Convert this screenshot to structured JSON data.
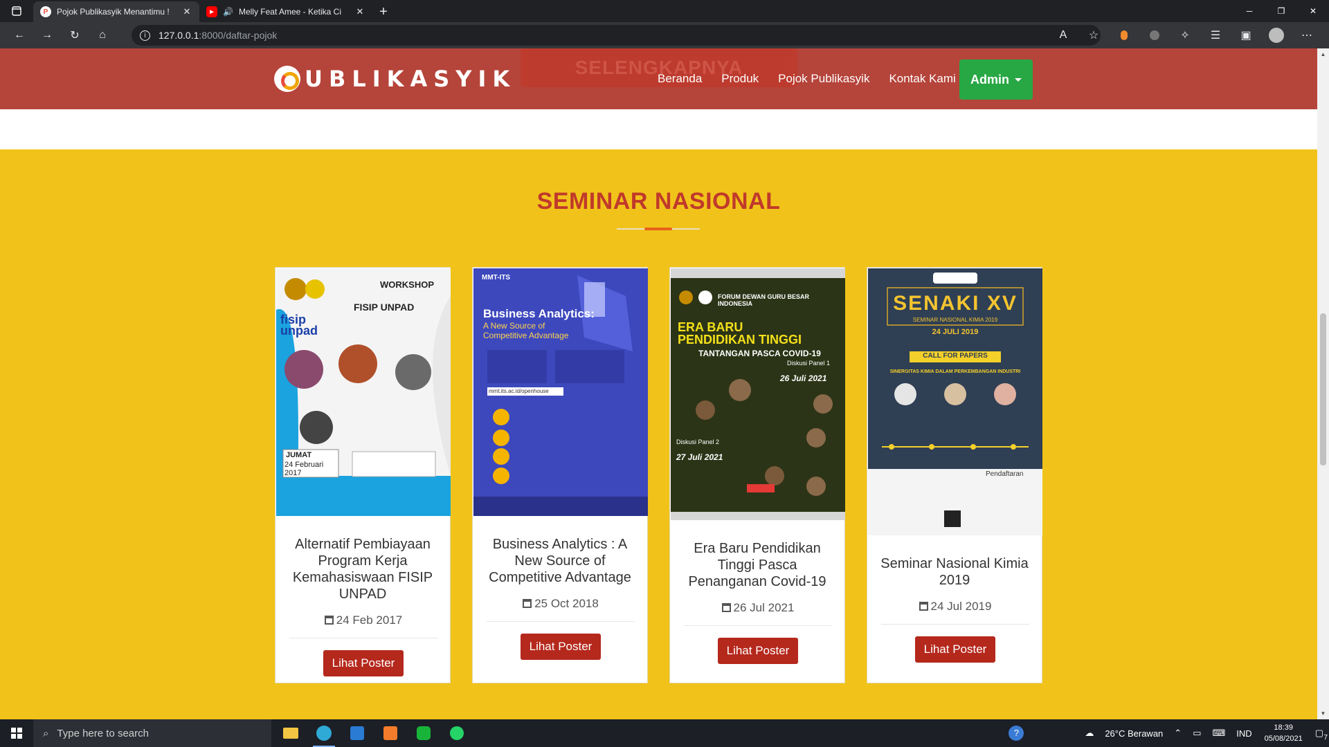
{
  "browser": {
    "tabs": [
      {
        "title": "Pojok Publikasyik Menantimu !",
        "active": true
      },
      {
        "title": "Melly Feat Amee - Ketika Ci",
        "active": false
      }
    ],
    "url_host": "127.0.0.1",
    "url_rest": ":8000/daftar-pojok"
  },
  "header": {
    "logo_text": "UBLIKASYIK",
    "ghost_button": "SELENGKAPNYA",
    "nav": [
      "Beranda",
      "Produk",
      "Pojok Publikasyik",
      "Kontak Kami"
    ],
    "admin_label": "Admin"
  },
  "section": {
    "title": "SEMINAR NASIONAL"
  },
  "cards": [
    {
      "title": "Alternatif Pembiayaan Program Kerja Kemahasiswaan FISIP UNPAD",
      "date": "24 Feb 2017",
      "button": "Lihat Poster",
      "poster": {
        "heading": "WORKSHOP",
        "subheading": "FISIP UNPAD",
        "brand": "fisip unpad",
        "day": "JUMAT",
        "date": "24 Februari 2017"
      }
    },
    {
      "title": "Business Analytics : A New Source of Competitive Advantage",
      "date": "25 Oct 2018",
      "button": "Lihat Poster",
      "poster": {
        "brand": "MMT-ITS",
        "heading": "Business Analytics:",
        "subheading": "A New Source of Competitive Advantage",
        "url": "mmt.its.ac.id/openhouse"
      }
    },
    {
      "title": "Era Baru Pendidikan Tinggi Pasca Penanganan Covid-19",
      "date": "26 Jul 2021",
      "button": "Lihat Poster",
      "poster": {
        "top": "FORUM DEWAN GURU BESAR INDONESIA",
        "heading": "ERA BARU PENDIDIKAN TINGGI",
        "subheading": "TANTANGAN PASCA COVID-19",
        "date1": "26 Juli 2021",
        "date2": "27 Juli 2021",
        "panel1": "Diskusi Panel 1",
        "panel2": "Diskusi Panel 2"
      }
    },
    {
      "title": "Seminar Nasional Kimia 2019",
      "date": "24 Jul 2019",
      "button": "Lihat Poster",
      "poster": {
        "heading": "SENAKI XV",
        "subheading": "SEMINAR NASIONAL KIMIA 2019",
        "date": "24 JULI 2019",
        "cfp": "CALL FOR PAPERS",
        "theme": "SINERGITAS KIMIA DALAM PERKEMBANGAN INDUSTRI",
        "reg": "Pendaftaran"
      }
    }
  ],
  "taskbar": {
    "search_placeholder": "Type here to search",
    "weather": "26°C  Berawan",
    "lang": "IND",
    "time": "18:39",
    "date": "05/08/2021",
    "notif_count": "7"
  },
  "colors": {
    "header": "#b5443a",
    "section_bg": "#f1c31a",
    "title": "#c0392b",
    "admin": "#28a745",
    "button": "#b5281c"
  }
}
